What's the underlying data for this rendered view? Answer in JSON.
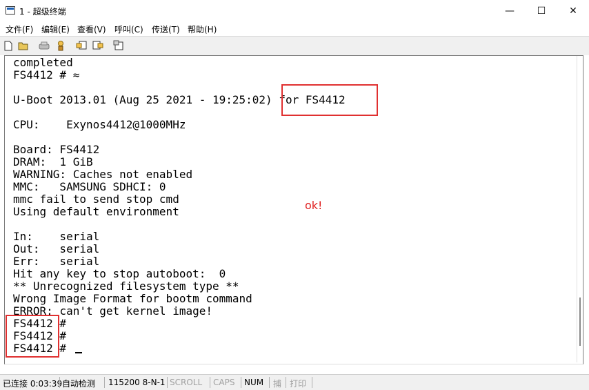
{
  "window": {
    "title": "1 - 超级终端",
    "minimize": "—",
    "maximize": "☐",
    "close": "✕"
  },
  "menu": [
    "文件(F)",
    "编辑(E)",
    "查看(V)",
    "呼叫(C)",
    "传送(T)",
    "帮助(H)"
  ],
  "toolbar": [
    "new-icon",
    "open-icon",
    "call-icon",
    "disconnect-icon",
    "send-icon",
    "receive-icon",
    "properties-icon"
  ],
  "terminal": {
    "lines": [
      "completed",
      "FS4412 # ≈",
      "",
      "U-Boot 2013.01 (Aug 25 2021 - 19:25:02) for FS4412",
      "",
      "CPU:    Exynos4412@1000MHz",
      "",
      "Board: FS4412",
      "DRAM:  1 GiB",
      "WARNING: Caches not enabled",
      "MMC:   SAMSUNG SDHCI: 0",
      "mmc fail to send stop cmd",
      "Using default environment",
      "",
      "In:    serial",
      "Out:   serial",
      "Err:   serial",
      "Hit any key to stop autoboot:  0",
      "** Unrecognized filesystem type **",
      "Wrong Image Format for bootm command",
      "ERROR: can't get kernel image!",
      "FS4412 #",
      "FS4412 #",
      "FS4412 #"
    ]
  },
  "annotation": {
    "text": "ok!",
    "color": "#e02020"
  },
  "status": {
    "connected": "已连接 0:03:39",
    "detect": "自动检测",
    "baud": "115200 8-N-1",
    "scroll": "SCROLL",
    "caps": "CAPS",
    "num": "NUM",
    "capture": "捕",
    "print": "打印"
  }
}
